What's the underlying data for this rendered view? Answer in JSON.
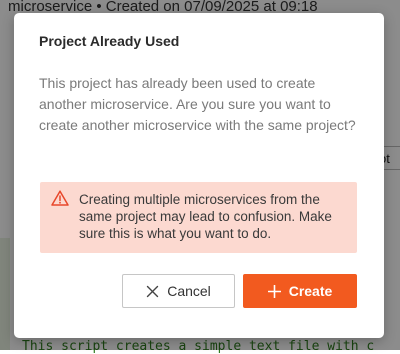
{
  "background": {
    "title": "microservice • Created on 07/09/2025 at 09:18",
    "right_pill_text": "ot",
    "code_line": "This script creates a simple text file with c"
  },
  "modal": {
    "title": "Project Already Used",
    "body": "This project has already been used to create another microservice. Are you sure you want to create another microservice with the same project?",
    "warning": {
      "icon": "warning-triangle-icon",
      "text": "Creating multiple microservices from the same project may lead to confusion. Make sure this is what you want to do.",
      "background_color": "#fcd9d0",
      "icon_color": "#e8472a"
    },
    "buttons": {
      "cancel": {
        "label": "Cancel",
        "icon": "close-icon"
      },
      "create": {
        "label": "Create",
        "icon": "plus-icon",
        "color": "#f25a1f"
      }
    }
  }
}
